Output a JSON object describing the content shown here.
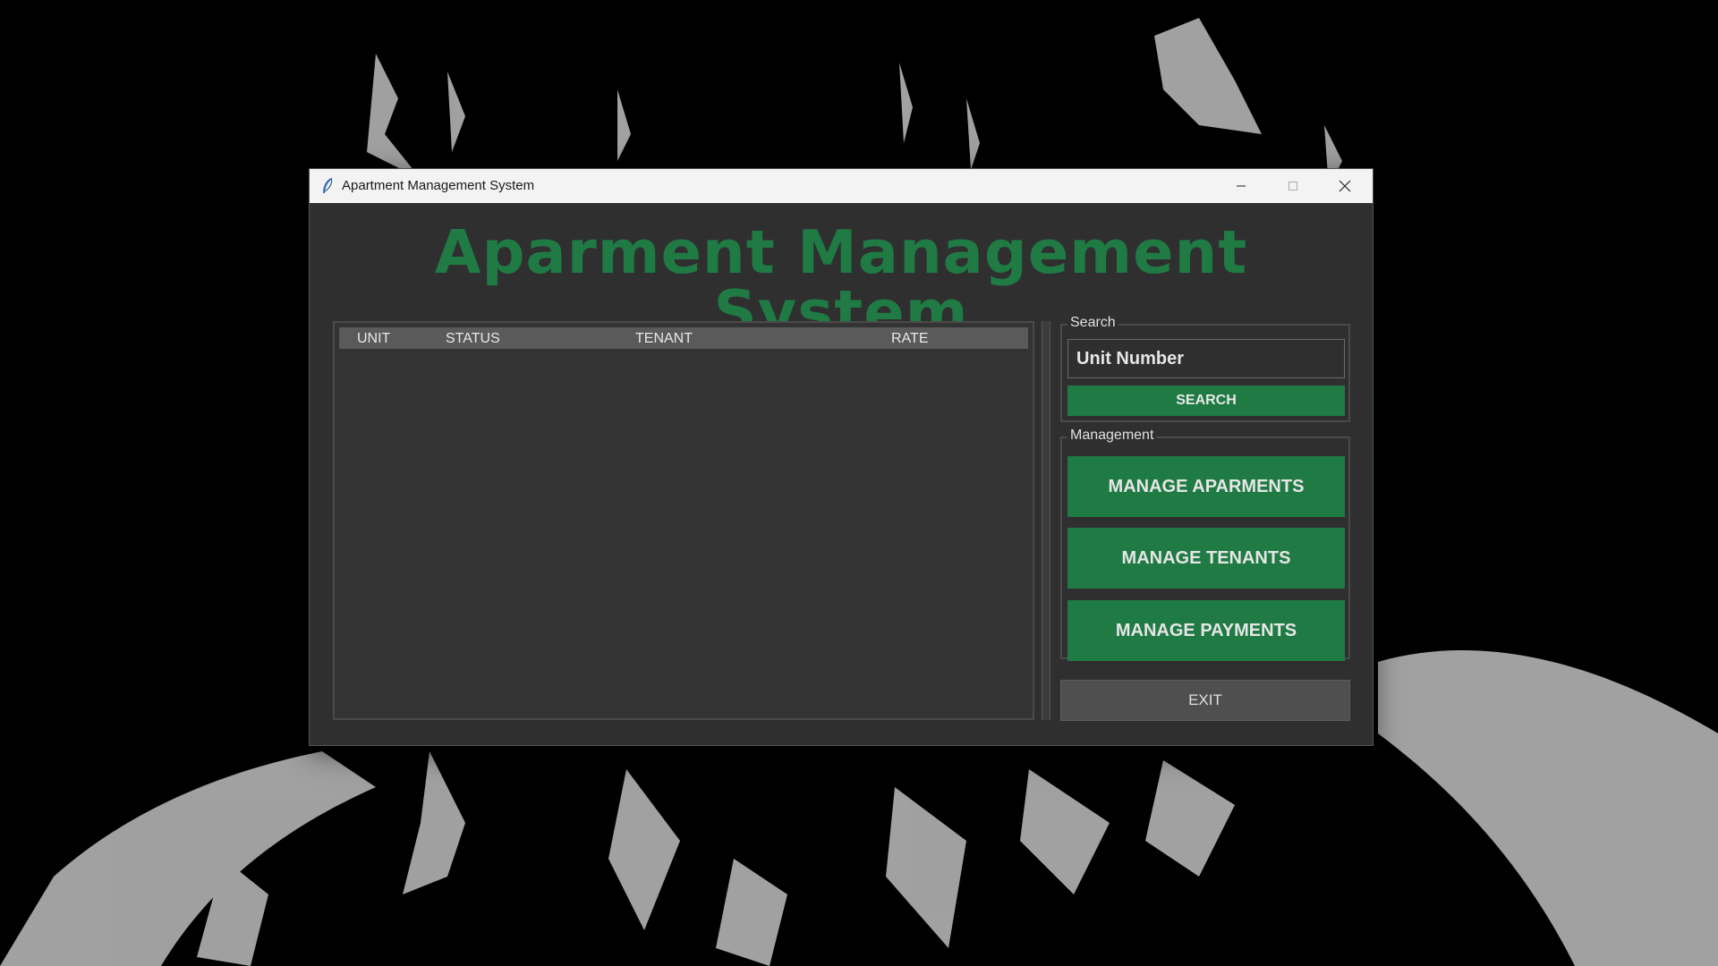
{
  "window": {
    "title": "Apartment Management System",
    "icon": "feather-icon"
  },
  "header": {
    "title": "Aparment Management System",
    "color": "#1f7a44"
  },
  "table": {
    "columns": [
      "UNIT",
      "STATUS",
      "TENANT",
      "RATE"
    ],
    "rows": []
  },
  "search": {
    "group_label": "Search",
    "input_value": "Unit Number",
    "button_label": "SEARCH"
  },
  "management": {
    "group_label": "Management",
    "buttons": [
      "MANAGE APARMENTS",
      "MANAGE TENANTS",
      "MANAGE PAYMENTS"
    ]
  },
  "exit": {
    "label": "EXIT"
  },
  "colors": {
    "accent": "#1f7a44",
    "background": "#2f2f2f"
  }
}
